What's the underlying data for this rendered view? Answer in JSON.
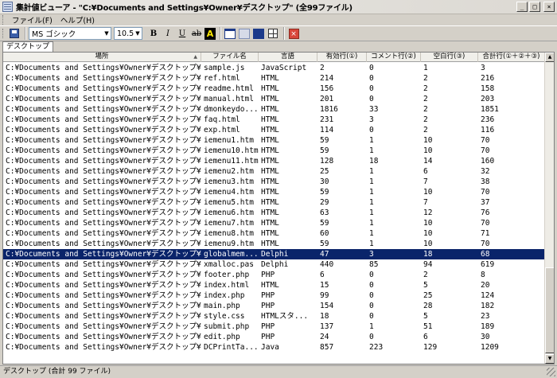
{
  "window": {
    "title": "集計値ビューア - \"C:¥Documents and Settings¥Owner¥デスクトップ\" (全99ファイル)",
    "minimize": "_",
    "maximize": "□",
    "close": "×"
  },
  "menu": [
    {
      "label": "ファイル(F)"
    },
    {
      "label": "ヘルプ(H)"
    }
  ],
  "toolbar": {
    "font_name": "MS ゴシック",
    "font_size": "10.5",
    "bold": "B",
    "italic": "I",
    "underline": "U",
    "strike": "ab",
    "highlight": "A",
    "close": "×"
  },
  "tabs": [
    {
      "label": "デスクトップ"
    }
  ],
  "columns": [
    "場所",
    "ファイル名",
    "言語",
    "有効行(①)",
    "コメント行(②)",
    "空白行(③)",
    "合計行(①＋②＋③)"
  ],
  "rows": [
    [
      "C:¥Documents and Settings¥Owner¥デスクトップ¥i...",
      "sample.js",
      "JavaScript",
      "2",
      "0",
      "1",
      "3"
    ],
    [
      "C:¥Documents and Settings¥Owner¥デスクトップ¥i...",
      "ref.html",
      "HTML",
      "214",
      "0",
      "2",
      "216"
    ],
    [
      "C:¥Documents and Settings¥Owner¥デスクトップ¥i...",
      "readme.html",
      "HTML",
      "156",
      "0",
      "2",
      "158"
    ],
    [
      "C:¥Documents and Settings¥Owner¥デスクトップ¥i...",
      "manual.html",
      "HTML",
      "201",
      "0",
      "2",
      "203"
    ],
    [
      "C:¥Documents and Settings¥Owner¥デスクトップ¥i...",
      "dmonkeydo...",
      "HTML",
      "1816",
      "33",
      "2",
      "1851"
    ],
    [
      "C:¥Documents and Settings¥Owner¥デスクトップ¥i...",
      "faq.html",
      "HTML",
      "231",
      "3",
      "2",
      "236"
    ],
    [
      "C:¥Documents and Settings¥Owner¥デスクトップ¥i...",
      "exp.html",
      "HTML",
      "114",
      "0",
      "2",
      "116"
    ],
    [
      "C:¥Documents and Settings¥Owner¥デスクトップ¥i...",
      "iemenu1.htm",
      "HTML",
      "59",
      "1",
      "10",
      "70"
    ],
    [
      "C:¥Documents and Settings¥Owner¥デスクトップ¥i...",
      "iemenu10.htm",
      "HTML",
      "59",
      "1",
      "10",
      "70"
    ],
    [
      "C:¥Documents and Settings¥Owner¥デスクトップ¥i...",
      "iemenu11.htm",
      "HTML",
      "128",
      "18",
      "14",
      "160"
    ],
    [
      "C:¥Documents and Settings¥Owner¥デスクトップ¥i...",
      "iemenu2.htm",
      "HTML",
      "25",
      "1",
      "6",
      "32"
    ],
    [
      "C:¥Documents and Settings¥Owner¥デスクトップ¥i...",
      "iemenu3.htm",
      "HTML",
      "30",
      "1",
      "7",
      "38"
    ],
    [
      "C:¥Documents and Settings¥Owner¥デスクトップ¥i...",
      "iemenu4.htm",
      "HTML",
      "59",
      "1",
      "10",
      "70"
    ],
    [
      "C:¥Documents and Settings¥Owner¥デスクトップ¥i...",
      "iemenu5.htm",
      "HTML",
      "29",
      "1",
      "7",
      "37"
    ],
    [
      "C:¥Documents and Settings¥Owner¥デスクトップ¥i...",
      "iemenu6.htm",
      "HTML",
      "63",
      "1",
      "12",
      "76"
    ],
    [
      "C:¥Documents and Settings¥Owner¥デスクトップ¥i...",
      "iemenu7.htm",
      "HTML",
      "59",
      "1",
      "10",
      "70"
    ],
    [
      "C:¥Documents and Settings¥Owner¥デスクトップ¥i...",
      "iemenu8.htm",
      "HTML",
      "60",
      "1",
      "10",
      "71"
    ],
    [
      "C:¥Documents and Settings¥Owner¥デスクトップ¥i...",
      "iemenu9.htm",
      "HTML",
      "59",
      "1",
      "10",
      "70"
    ],
    [
      "C:¥Documents and Settings¥Owner¥デスクトップ¥i...",
      "globalmem...",
      "Delphi",
      "47",
      "3",
      "18",
      "68"
    ],
    [
      "C:¥Documents and Settings¥Owner¥デスクトップ¥i...",
      "xmalloc.pas",
      "Delphi",
      "440",
      "85",
      "94",
      "619"
    ],
    [
      "C:¥Documents and Settings¥Owner¥デスクトップ¥...",
      "footer.php",
      "PHP",
      "6",
      "0",
      "2",
      "8"
    ],
    [
      "C:¥Documents and Settings¥Owner¥デスクトップ¥...",
      "index.html",
      "HTML",
      "15",
      "0",
      "5",
      "20"
    ],
    [
      "C:¥Documents and Settings¥Owner¥デスクトップ¥...",
      "index.php",
      "PHP",
      "99",
      "0",
      "25",
      "124"
    ],
    [
      "C:¥Documents and Settings¥Owner¥デスクトップ¥...",
      "main.php",
      "PHP",
      "154",
      "0",
      "28",
      "182"
    ],
    [
      "C:¥Documents and Settings¥Owner¥デスクトップ¥...",
      "style.css",
      "HTMLスタ...",
      "18",
      "0",
      "5",
      "23"
    ],
    [
      "C:¥Documents and Settings¥Owner¥デスクトップ¥...",
      "submit.php",
      "PHP",
      "137",
      "1",
      "51",
      "189"
    ],
    [
      "C:¥Documents and Settings¥Owner¥デスクトップ¥...",
      "edit.php",
      "PHP",
      "24",
      "0",
      "6",
      "30"
    ],
    [
      "C:¥Documents and Settings¥Owner¥デスクトップ¥一覧",
      "DCPrintTa...",
      "Java",
      "857",
      "223",
      "129",
      "1209"
    ]
  ],
  "selected_row": 18,
  "status": "デスクトップ (合計 99 ファイル)"
}
